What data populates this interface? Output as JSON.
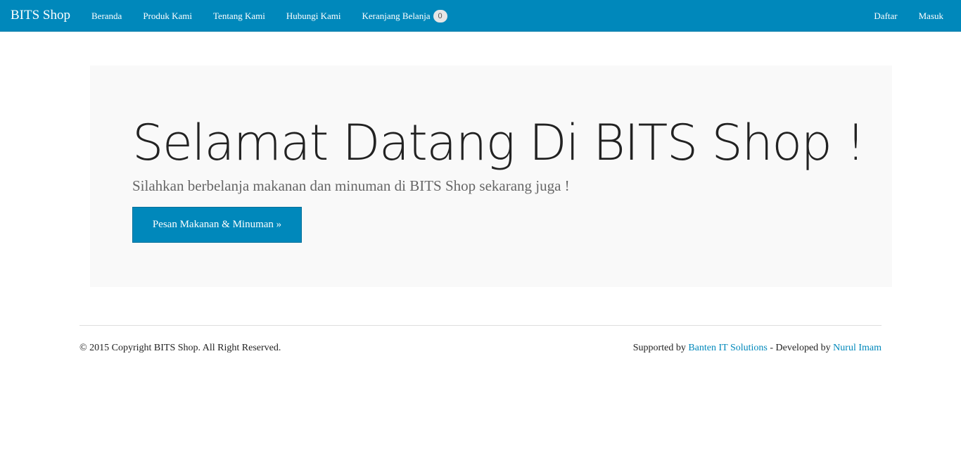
{
  "navbar": {
    "brand": "BITS Shop",
    "items": [
      {
        "label": "Beranda"
      },
      {
        "label": "Produk Kami"
      },
      {
        "label": "Tentang Kami"
      },
      {
        "label": "Hubungi Kami"
      },
      {
        "label": "Keranjang Belanja",
        "badge": "0"
      }
    ],
    "right_items": [
      {
        "label": "Daftar"
      },
      {
        "label": "Masuk"
      }
    ],
    "colors": {
      "background": "#0088bb",
      "badge": "#e6e6e6"
    }
  },
  "hero": {
    "title": "Selamat Datang Di BITS Shop !",
    "subtitle": "Silahkan berbelanja makanan dan minuman di BITS Shop sekarang juga !",
    "button_label": "Pesan Makanan & Minuman »"
  },
  "footer": {
    "copyright": "© 2015 Copyright BITS Shop. All Right Reserved.",
    "supported_prefix": "Supported by ",
    "supported_link": "Banten IT Solutions",
    "developed_prefix": " - Developed by ",
    "developer_link": "Nurul Imam",
    "link_color": "#0088bb"
  }
}
